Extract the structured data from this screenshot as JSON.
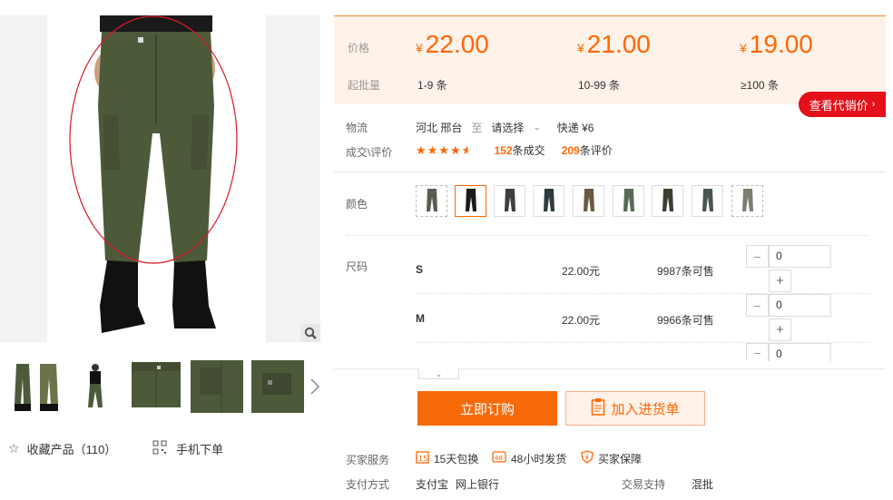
{
  "gallery": {
    "favorite_label": "收藏产品",
    "favorite_count": "（110）",
    "mobile_order_label": "手机下单"
  },
  "price": {
    "label": "价格",
    "moq_label": "起批量",
    "currency": "¥",
    "tiers": [
      {
        "price": "22.00",
        "range": "1-9 条"
      },
      {
        "price": "21.00",
        "range": "10-99 条"
      },
      {
        "price": "19.00",
        "range": "≥100 条"
      }
    ],
    "agent_price_button": "查看代销价"
  },
  "logistics": {
    "label": "物流",
    "origin": "河北 邢台",
    "to": "至",
    "destination": "请选择",
    "shipping": "快递 ¥6"
  },
  "reviews": {
    "label": "成交\\评价",
    "rating": 4.5,
    "deals_count": "152",
    "deals_suffix": "条成交",
    "review_count": "209",
    "review_suffix": "条评价"
  },
  "color": {
    "label": "颜色",
    "selected_index": 1,
    "swatch_count": 9
  },
  "size": {
    "label": "尺码",
    "rows": [
      {
        "name": "S",
        "price": "22.00元",
        "stock": "9987条可售",
        "qty": "0"
      },
      {
        "name": "M",
        "price": "22.00元",
        "stock": "9966条可售",
        "qty": "0"
      },
      {
        "name": "",
        "price": "",
        "stock": "",
        "qty": "0"
      }
    ]
  },
  "buttons": {
    "buy_now": "立即订购",
    "add_to_cart": "加入进货单"
  },
  "services": {
    "label": "买家服务",
    "items": [
      "15天包换",
      "48小时发货",
      "买家保障"
    ],
    "payment_label": "支付方式",
    "payments": [
      "支付宝",
      "网上银行"
    ],
    "trade_label": "交易支持",
    "trade_value": "混批"
  },
  "colors": {
    "accent": "#ff6600",
    "agent_red": "#e4101a",
    "price_bg": "#fff2e8"
  }
}
